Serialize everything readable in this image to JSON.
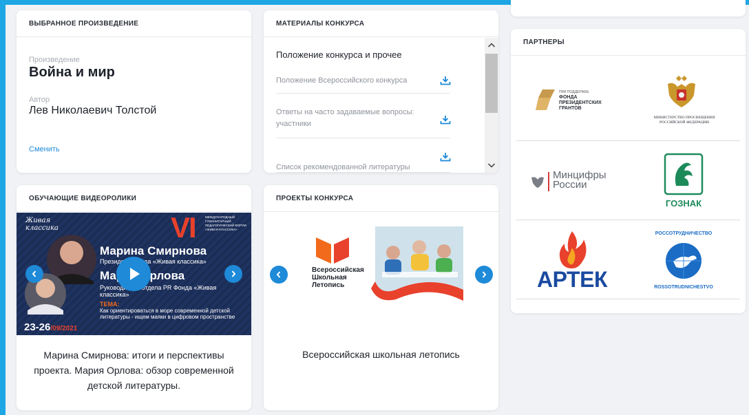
{
  "work_card": {
    "title": "ВЫБРАННОЕ ПРОИЗВЕДЕНИЕ",
    "work_label": "Произведение",
    "work_value": "Война и мир",
    "author_label": "Автор",
    "author_value": "Лев Николаевич Толстой",
    "change_link": "Сменить"
  },
  "materials_card": {
    "title": "МАТЕРИАЛЫ КОНКУРСА",
    "section_heading": "Положение конкурса и прочее",
    "items": [
      "Положение Всероссийского конкурса",
      "Ответы на часто задаваемые вопросы: участники",
      "Список рекомендованной литературы"
    ]
  },
  "videos_card": {
    "title": "ОБУЧАЮЩИЕ ВИДЕОРОЛИКИ",
    "thumbnail": {
      "brand_line1": "Живая",
      "brand_line2": "классика",
      "numeral": "VI",
      "forum_text": "МЕЖДУНАРОДНЫЙ ГУМАНИТАРНЫЙ ПЕДАГОГИЧЕСКИЙ ФОРУМ «ЖИВАЯ КЛАССИКА»",
      "speaker1_name": "Марина Смирнова",
      "speaker1_role": "Президент Фонда «Живая классика»",
      "speaker2_name": "Мария Орлова",
      "speaker2_role": "Руководитель отдела PR Фонда «Живая классика»",
      "topic_label": "ТЕМА:",
      "topic_text": "Как ориентироваться в море современной детской литературы - ищем маяки в цифровом пространстве",
      "dates": "23-26",
      "month_year": "/09/2021"
    },
    "caption": "Марина Смирнова: итоги и перспективы проекта. Мария Орлова: обзор современной детской литературы."
  },
  "projects_card": {
    "title": "ПРОЕКТЫ КОНКУРСА",
    "banner_line1": "Всероссийская",
    "banner_line2": "Школьная",
    "banner_line3": "Летопись",
    "caption": "Всероссийская школьная летопись"
  },
  "partners_card": {
    "title": "ПАРТНЕРЫ",
    "logos": {
      "fpg_small": "ПРИ ПОДДЕРЖКЕ",
      "fpg_l1": "ФОНДА",
      "fpg_l2": "ПРЕЗИДЕНТСКИХ",
      "fpg_l3": "ГРАНТОВ",
      "minpros_l1": "МИНИСТЕРСТВО ПРОСВЕЩЕНИЯ",
      "minpros_l2": "РОССИЙСКОЙ ФЕДЕРАЦИИ",
      "mincifry_l1": "Минцифры",
      "mincifry_l2": "России",
      "goznak": "ГОЗНАК",
      "artek": "АРТЕК",
      "rossotr_top": "РОССОТРУДНИЧЕСТВО",
      "rossotr_bottom": "ROSSOTRUDNICHESTVO"
    }
  },
  "colors": {
    "accent_blue": "#1e8ad8",
    "frame_blue": "#1ea7e4",
    "video_bg": "#1b2d55",
    "video_red": "#e8412c",
    "brand_orange": "#f26a1b"
  }
}
